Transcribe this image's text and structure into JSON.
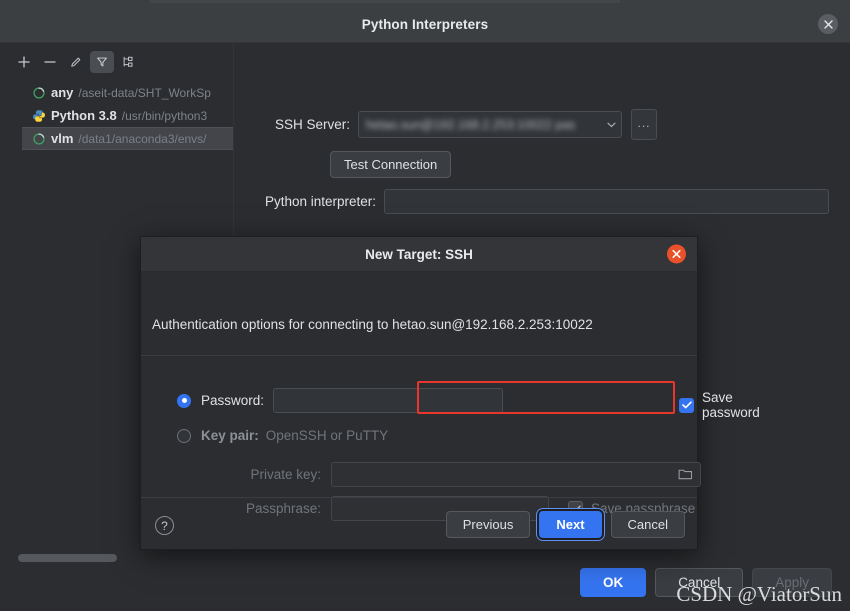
{
  "window": {
    "title": "Python Interpreters",
    "close_icon": "close-icon"
  },
  "toolbar": {
    "add": "+",
    "remove": "−",
    "edit": "pencil-icon",
    "filter": "filter-icon",
    "show_tree": "tree-icon"
  },
  "interpreters": [
    {
      "name": "any",
      "path": "/aseit-data/SHT_WorkSp",
      "icon": "conda-env-icon",
      "selected": false
    },
    {
      "name": "Python 3.8",
      "path": "/usr/bin/python3",
      "icon": "python-icon",
      "selected": false
    },
    {
      "name": "vlm",
      "path": "/data1/anaconda3/envs/",
      "icon": "conda-env-icon",
      "selected": true
    }
  ],
  "form": {
    "ssh_server_label": "SSH Server:",
    "ssh_server_value": "hetao.sun@192.168.2.253:10022 pas",
    "browse_label": "...",
    "test_connection_label": "Test Connection",
    "python_interpreter_label": "Python interpreter:",
    "python_interpreter_value": "",
    "python_interpreter_placeholder": ""
  },
  "bottom_bar": {
    "ok_label": "OK",
    "cancel_label": "Cancel",
    "apply_label": "Apply"
  },
  "modal": {
    "title": "New Target: SSH",
    "close_icon": "close-icon",
    "description": "Authentication options for connecting to hetao.sun@192.168.2.253:10022",
    "password_label": "Password:",
    "password_value": "",
    "save_password_label": "Save password",
    "keypair_label": "Key pair:",
    "keypair_hint": "OpenSSH or PuTTY",
    "private_key_label": "Private key:",
    "private_key_value": "",
    "private_key_browse_icon": "folder-icon",
    "passphrase_label": "Passphrase:",
    "passphrase_value": "",
    "save_passphrase_label": "Save passphrase",
    "help_label": "?",
    "previous_label": "Previous",
    "next_label": "Next",
    "cancel_label": "Cancel"
  },
  "watermark": {
    "text": "CSDN @ViatorSun"
  },
  "colors": {
    "accent": "#3574f0",
    "highlight": "#e8362b",
    "modal_close": "#e8512a",
    "window_bg": "#2b2d30",
    "titlebar_bg": "#3c3f41"
  }
}
